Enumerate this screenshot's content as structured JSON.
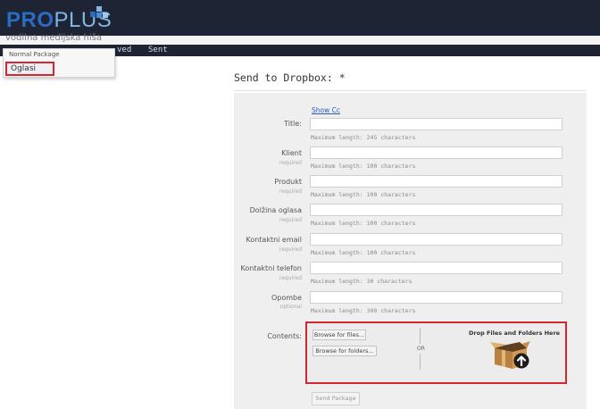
{
  "brand": {
    "logo_pro": "PRO",
    "logo_plus": "PLUS",
    "subtitle": "vodilna medijska hiša",
    "colors": {
      "pro": "#2a6cc4",
      "plus": "#7fb6e4",
      "topbar": "#1e2433"
    }
  },
  "nav": {
    "received": "ved",
    "sent": "Sent"
  },
  "dropdown": {
    "title": "Normal Package",
    "selected_item": "Oglasi"
  },
  "form": {
    "title": "Send to Dropbox: *",
    "show_cc": "Show Cc",
    "fields": [
      {
        "label": "Title:",
        "requirement": "",
        "hint": "Maximum length: 245 characters",
        "value": ""
      },
      {
        "label": "Klient",
        "requirement": "required",
        "hint": "Maximum length: 100 characters",
        "value": ""
      },
      {
        "label": "Produkt",
        "requirement": "required",
        "hint": "Maximum length: 100 characters",
        "value": ""
      },
      {
        "label": "Dolžina oglasa",
        "requirement": "required",
        "hint": "Maximum length: 100 characters",
        "value": ""
      },
      {
        "label": "Kontaktni email",
        "requirement": "required",
        "hint": "Maximum length: 100 characters",
        "value": ""
      },
      {
        "label": "Kontaktni telefon",
        "requirement": "required",
        "hint": "Maximum length: 30 characters",
        "value": ""
      },
      {
        "label": "Opombe",
        "requirement": "optional",
        "hint": "Maximum length: 300 characters",
        "value": ""
      }
    ],
    "contents_label": "Contents:",
    "browse_files": "Browse for files...",
    "browse_folders": "Browse for folders...",
    "or_text": "OR",
    "drop_label": "Drop Files and Folders Here",
    "drop_icon": "open-box-upload-icon",
    "send_button": "Send Package",
    "highlight_color": "#d6262d"
  }
}
